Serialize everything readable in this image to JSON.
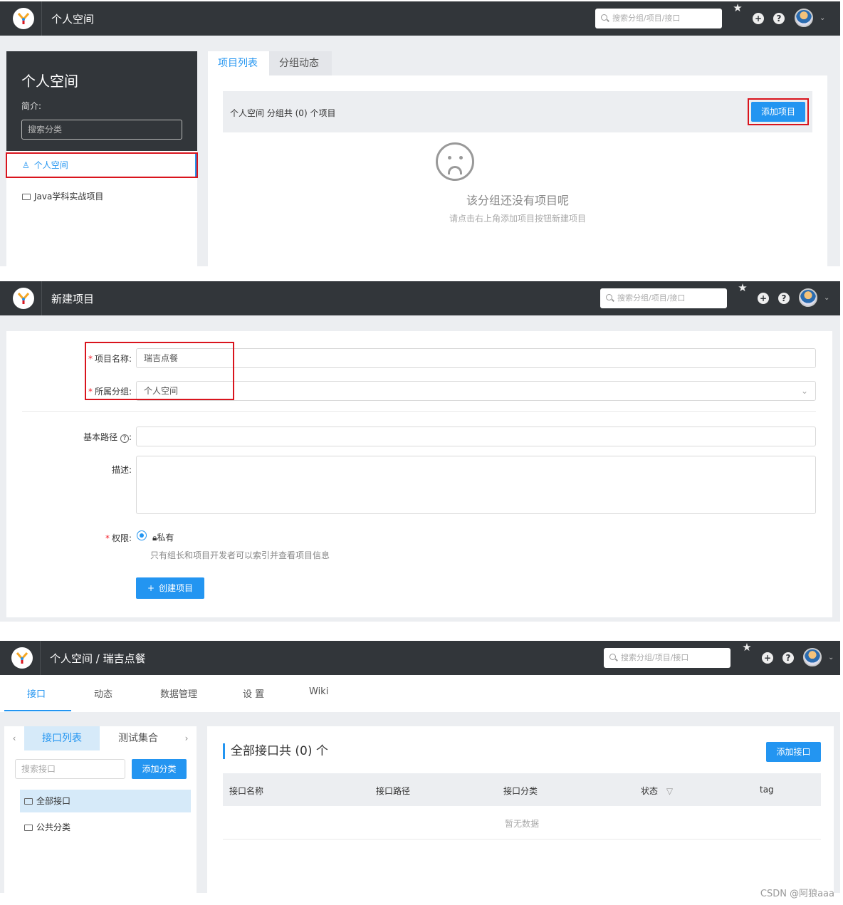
{
  "header": {
    "search_placeholder": "搜索分组/项目/接口",
    "panel1_title": "个人空间",
    "panel2_title": "新建项目",
    "panel3_title": "个人空间 / 瑞吉点餐"
  },
  "group_page": {
    "sidebar": {
      "title": "个人空间",
      "intro_label": "简介:",
      "search_placeholder": "搜索分类",
      "items": [
        {
          "label": "个人空间",
          "active": true
        },
        {
          "label": "Java学科实战项目",
          "active": false
        }
      ]
    },
    "tabs": [
      "项目列表",
      "分组动态"
    ],
    "info_text": "个人空间 分组共 (0) 个项目",
    "add_button": "添加项目",
    "empty_title": "该分组还没有项目呢",
    "empty_hint": "请点击右上角添加项目按钮新建项目"
  },
  "new_project": {
    "name_label": "项目名称:",
    "name_value": "瑞吉点餐",
    "group_label": "所属分组:",
    "group_value": "个人空间",
    "basepath_label": "基本路径",
    "basepath_colon": ":",
    "desc_label": "描述:",
    "permission_label": "权限:",
    "permission_option": "私有",
    "permission_hint": "只有组长和项目开发者可以索引并查看项目信息",
    "create_button": "创建项目"
  },
  "project_page": {
    "nav_tabs": [
      "接口",
      "动态",
      "数据管理",
      "设 置",
      "Wiki"
    ],
    "left_tabs": [
      "接口列表",
      "测试集合"
    ],
    "search_placeholder": "搜索接口",
    "add_category_button": "添加分类",
    "categories": [
      "全部接口",
      "公共分类"
    ],
    "section_title": "全部接口共 (0) 个",
    "add_interface_button": "添加接口",
    "columns": [
      "接口名称",
      "接口路径",
      "接口分类",
      "状态",
      "tag"
    ],
    "empty_text": "暂无数据"
  },
  "watermark": "CSDN @阿狼aaa",
  "colors": {
    "accent": "#2395f1",
    "header": "#32363a",
    "highlight": "#d9141d"
  }
}
